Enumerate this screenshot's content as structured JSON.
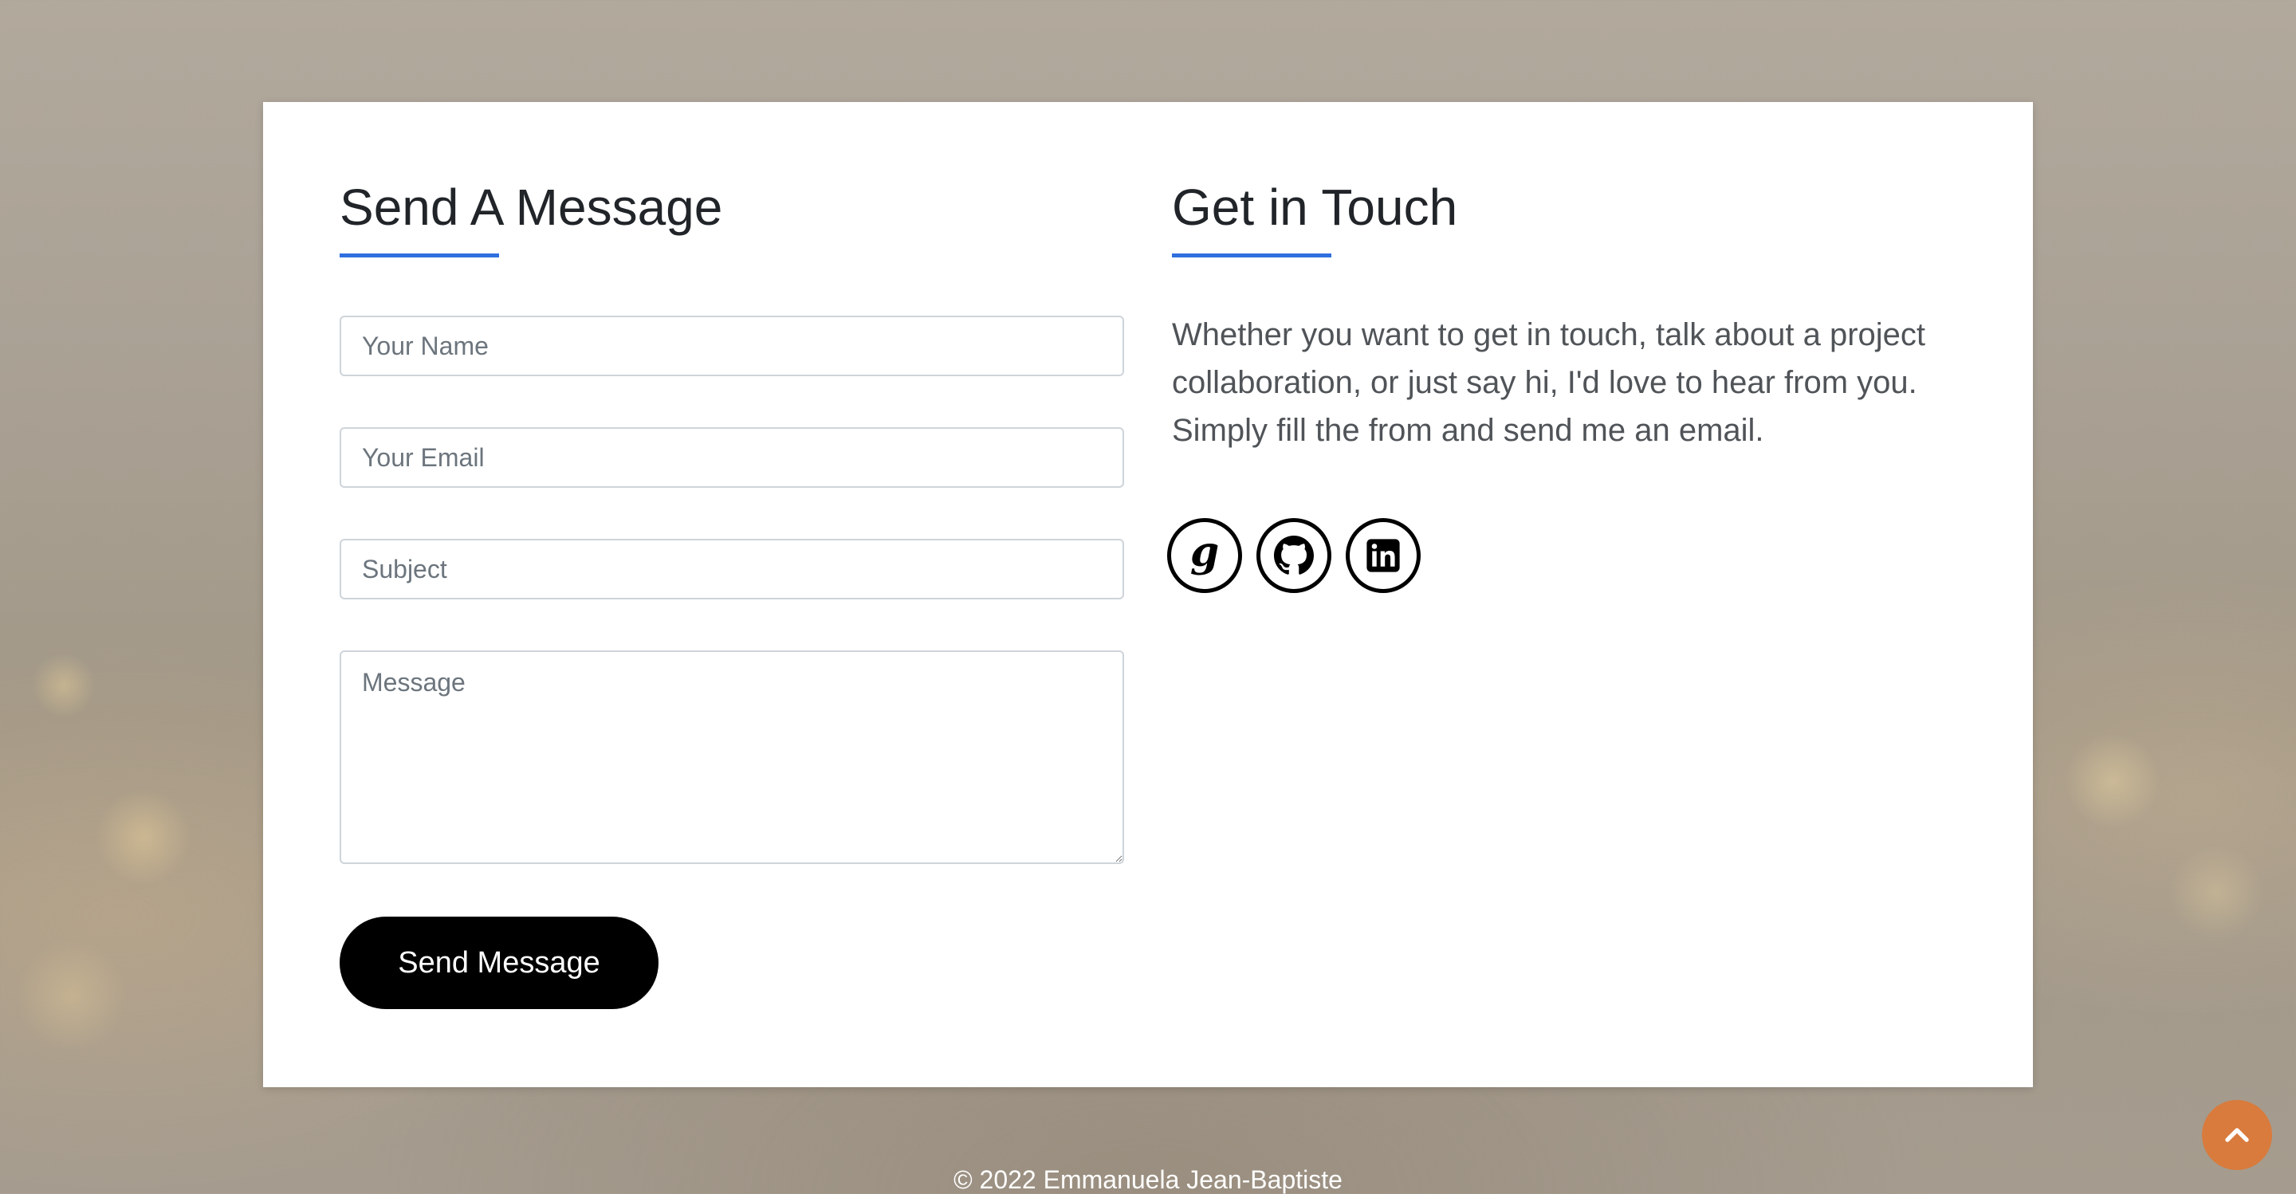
{
  "send_section": {
    "title": "Send A Message",
    "fields": {
      "name_placeholder": "Your Name",
      "email_placeholder": "Your Email",
      "subject_placeholder": "Subject",
      "message_placeholder": "Message"
    },
    "submit_label": "Send Message"
  },
  "contact_section": {
    "title": "Get in Touch",
    "intro": "Whether you want to get in touch, talk about a project collaboration, or just say hi, I'd love to hear from you. Simply fill the from and send me an email.",
    "socials": [
      {
        "icon": "google-icon"
      },
      {
        "icon": "github-icon"
      },
      {
        "icon": "linkedin-icon"
      }
    ]
  },
  "footer": {
    "copyright": "© 2022 Emmanuela Jean-Baptiste"
  },
  "colors": {
    "accent": "#2f6fde",
    "button_bg": "#000000",
    "scroll_top_bg": "#d87b3d"
  }
}
